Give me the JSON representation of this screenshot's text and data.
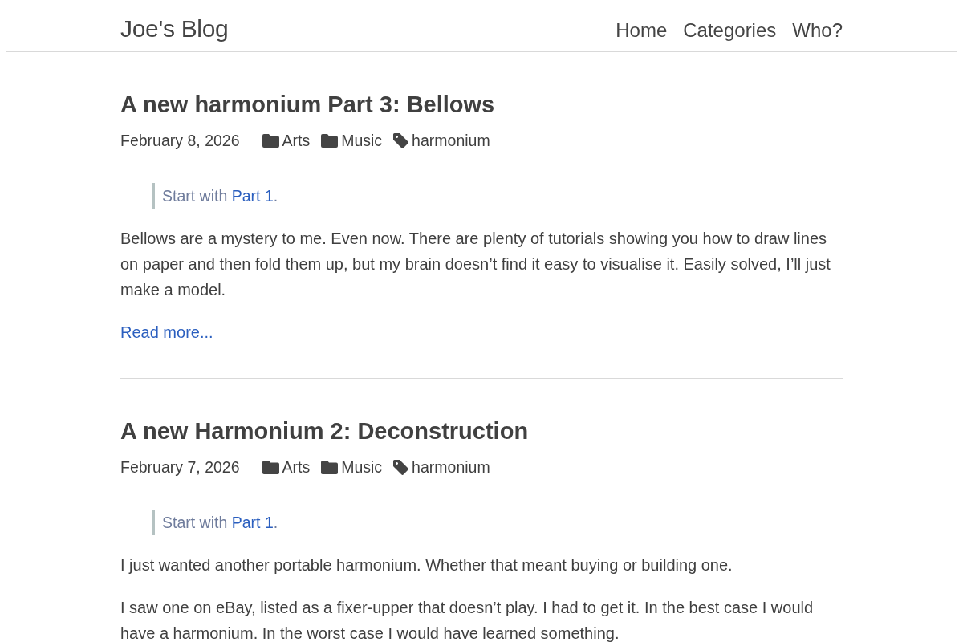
{
  "header": {
    "site_title": "Joe's Blog",
    "nav": [
      {
        "label": "Home"
      },
      {
        "label": "Categories"
      },
      {
        "label": "Who?"
      }
    ]
  },
  "posts": [
    {
      "title": "A new harmonium Part 3: Bellows",
      "date": "February 8, 2026",
      "categories": [
        "Arts",
        "Music"
      ],
      "tags": [
        "harmonium"
      ],
      "note": {
        "before": "Start with ",
        "link": "Part 1",
        "after": "."
      },
      "paragraphs": [
        "Bellows are a mystery to me. Even now. There are plenty of tutorials showing you how to draw lines on paper and then fold them up, but my brain doesn’t find it easy to visualise it. Easily solved, I’ll just make a model."
      ],
      "read_more": "Read more..."
    },
    {
      "title": "A new Harmonium 2: Deconstruction",
      "date": "February 7, 2026",
      "categories": [
        "Arts",
        "Music"
      ],
      "tags": [
        "harmonium"
      ],
      "note": {
        "before": "Start with ",
        "link": "Part 1",
        "after": "."
      },
      "paragraphs": [
        "I just wanted another portable harmonium. Whether that meant buying or building one.",
        "I saw one on eBay, listed as a fixer-upper that doesn’t play. I had to get it. In the best case I would have a harmonium. In the worst case I would have learned something."
      ]
    }
  ]
}
